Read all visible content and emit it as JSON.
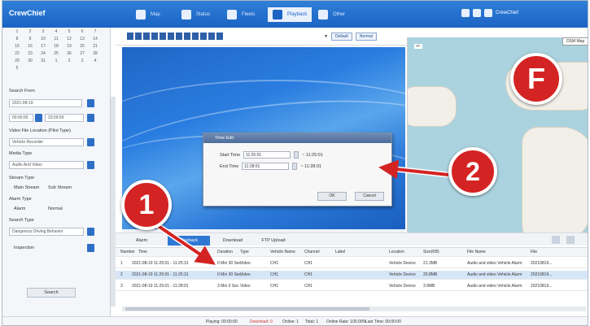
{
  "app": {
    "title": "CrewChief"
  },
  "nav": [
    {
      "label": "Map",
      "active": false
    },
    {
      "label": "Status",
      "active": false
    },
    {
      "label": "Fleets",
      "active": false
    },
    {
      "label": "Playback",
      "active": true
    },
    {
      "label": "Other",
      "active": false
    }
  ],
  "topright": {
    "user": "CrewChief"
  },
  "sidebar": {
    "calendar": [
      "1",
      "2",
      "3",
      "4",
      "5",
      "6",
      "7",
      "8",
      "9",
      "10",
      "11",
      "12",
      "13",
      "14",
      "15",
      "16",
      "17",
      "18",
      "19",
      "20",
      "21",
      "22",
      "23",
      "24",
      "25",
      "26",
      "27",
      "28",
      "29",
      "30",
      "31",
      "1",
      "2",
      "3",
      "4",
      "5"
    ],
    "search_from_label": "Search From",
    "search_from_value": "2021-08-19",
    "time_label": "00:00:00",
    "time_end": "23:59:59",
    "video_label": "Video File Location (Pilot Type)",
    "video_value": "Vehicle Recorder",
    "media_label": "Media Type",
    "media_value": "Audio And Video",
    "stream_label": "Stream Type",
    "stream_a": "Main Stream",
    "stream_b": "Sub Stream",
    "alarm_label": "Alarm Type",
    "alarm_a": "Alarm",
    "alarm_b": "Normal",
    "search_type_label": "Search Type",
    "search_type_value": "Dangerous Driving Behavior",
    "inspection_label": "Inspection",
    "search_button": "Search"
  },
  "toolbar": {
    "select_a": "Default",
    "select_b": "Normal",
    "map_button": "OSM Map"
  },
  "dialog": {
    "title": "Time Edit",
    "start_label": "Start Time",
    "start_value": "11:25:01",
    "start_range": "~ 11:25:01",
    "end_label": "End Time",
    "end_value": "11:28:01",
    "end_range": "~ 11:28:01",
    "ok": "OK",
    "cancel": "Cancel"
  },
  "tabs": [
    "Alarm",
    "Playback",
    "Download",
    "FTP Upload"
  ],
  "table": {
    "headers": [
      "Number",
      "Time",
      "Duration",
      "Type",
      "Vehicle Name",
      "Channel",
      "Label",
      "Location",
      "Size(KB)",
      "File Name",
      "File"
    ],
    "rows": [
      [
        "1",
        "2021-08-19 11:25:01 - 11:25:31",
        "0 Min 30 Sec",
        "Video",
        "CH1",
        "CH1",
        "",
        "Vehicle Device",
        "21.3MB",
        "Audio and video Vehicle Alarm",
        "20210819..."
      ],
      [
        "2",
        "2021-08-19 11:25:01 - 11:25:31",
        "0 Min 30 Sec",
        "Video",
        "CH1",
        "CH1",
        "",
        "Vehicle Device",
        "20.8MB",
        "Audio and video Vehicle Alarm",
        "20210819..."
      ],
      [
        "3",
        "2021-08-19 11:25:01 - 11:28:01",
        "3 Min 0 Sec",
        "Video",
        "CH1",
        "CH1",
        "",
        "Vehicle Device",
        "3.9MB",
        "Audio and video Vehicle Alarm",
        "20210819..."
      ]
    ]
  },
  "status": {
    "a": "Playing: 00:00:00",
    "b": "Download: 0",
    "c": "Online: 1",
    "d": "Total: 1",
    "e": "Online Rate: 100.00%",
    "f": "Last Time: 00:00:00"
  },
  "callouts": {
    "one": "1",
    "two": "2",
    "f": "F"
  },
  "colors": {
    "accent": "#2e78d4",
    "callout": "#d42323"
  }
}
